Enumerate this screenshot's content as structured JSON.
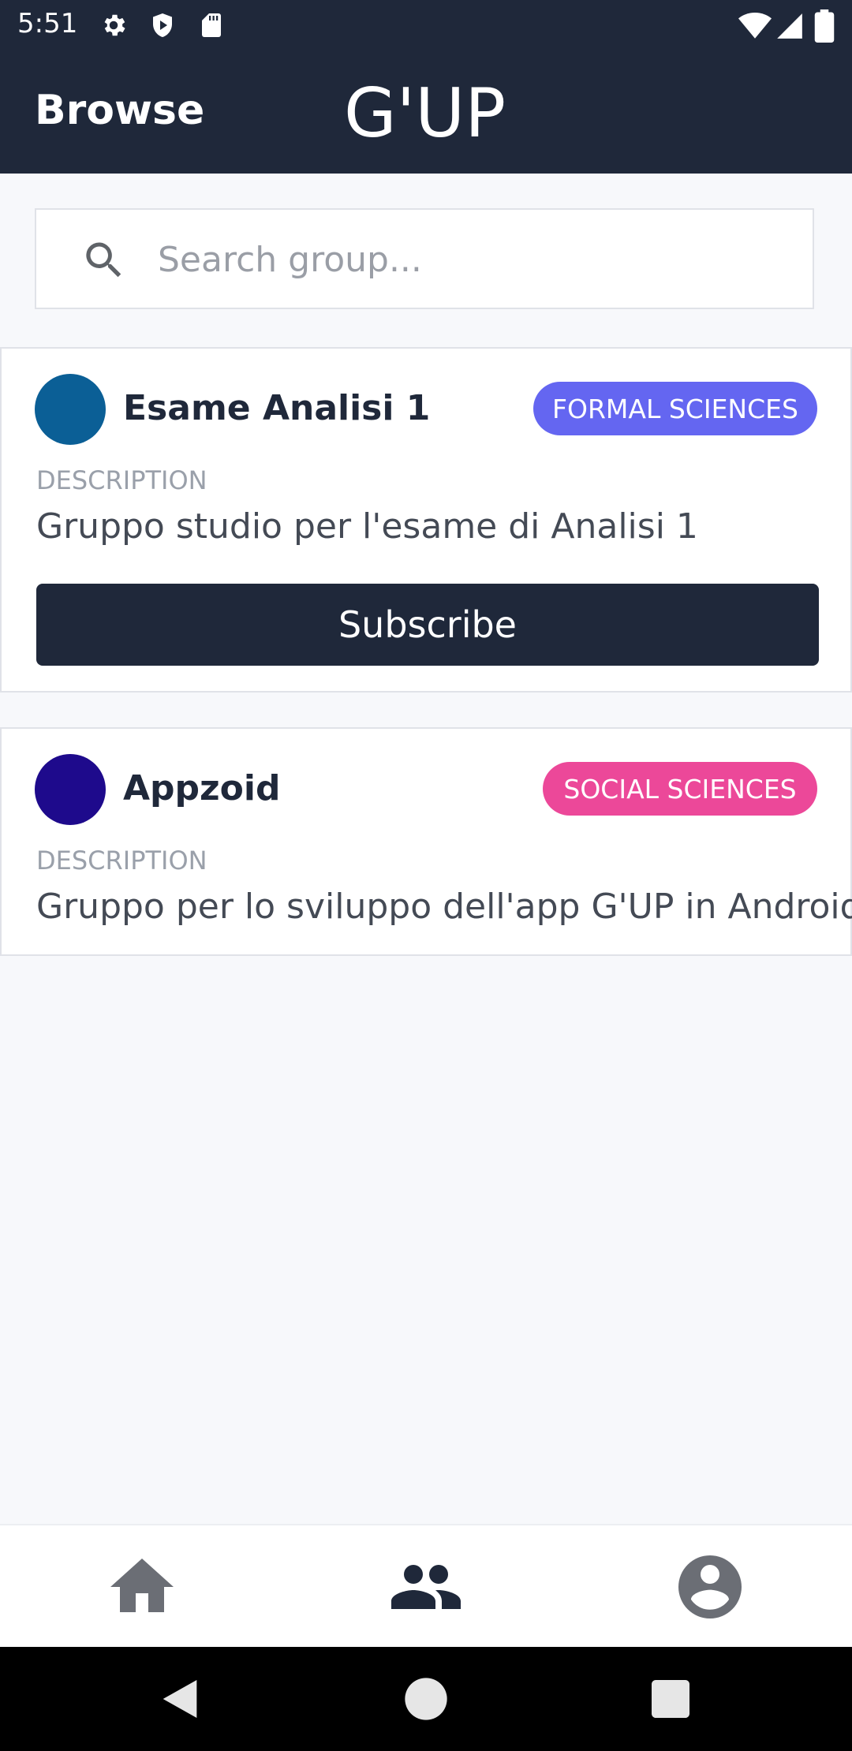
{
  "status_bar": {
    "time": "5:51",
    "left_icons": [
      "gear-icon",
      "shield-icon",
      "sd-card-icon"
    ],
    "right_icons": [
      "wifi-icon",
      "signal-icon",
      "battery-icon"
    ]
  },
  "app_bar": {
    "title": "Browse",
    "brand": "G'UP"
  },
  "search": {
    "placeholder": "Search group..."
  },
  "groups": [
    {
      "name": "Esame Analisi 1",
      "avatar_color": "#0b5f96",
      "tag": "FORMAL SCIENCES",
      "tag_color": "#6466f1",
      "description_label": "DESCRIPTION",
      "description": "Gruppo studio per l'esame di Analisi 1",
      "action_label": "Subscribe"
    },
    {
      "name": "Appzoid",
      "avatar_color": "#1e0a8c",
      "tag": "SOCIAL SCIENCES",
      "tag_color": "#ec4899",
      "description_label": "DESCRIPTION",
      "description": "Gruppo per lo sviluppo dell'app G'UP in Android!"
    }
  ],
  "bottom_nav": {
    "items": [
      "home-icon",
      "groups-icon",
      "account-icon"
    ],
    "active": "groups-icon"
  },
  "colors": {
    "primary": "#1f283a",
    "background": "#f7f8fb"
  }
}
